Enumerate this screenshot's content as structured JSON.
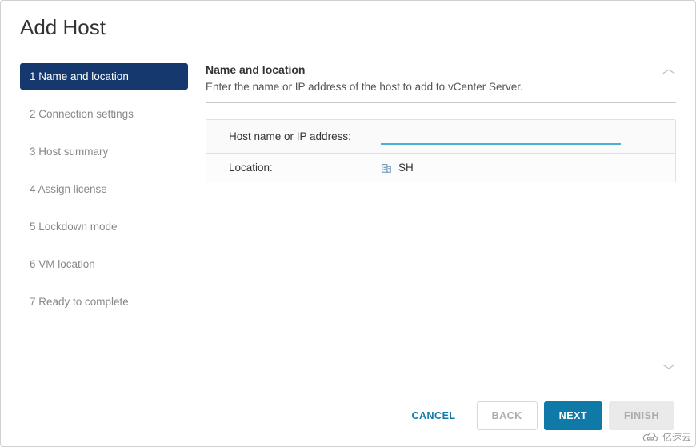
{
  "dialog": {
    "title": "Add Host"
  },
  "sidebar": {
    "steps": [
      {
        "label": "1 Name and location",
        "active": true
      },
      {
        "label": "2 Connection settings",
        "active": false
      },
      {
        "label": "3 Host summary",
        "active": false
      },
      {
        "label": "4 Assign license",
        "active": false
      },
      {
        "label": "5 Lockdown mode",
        "active": false
      },
      {
        "label": "6 VM location",
        "active": false
      },
      {
        "label": "7 Ready to complete",
        "active": false
      }
    ]
  },
  "content": {
    "heading": "Name and location",
    "description": "Enter the name or IP address of the host to add to vCenter Server.",
    "fields": {
      "hostname_label": "Host name or IP address:",
      "hostname_value": "",
      "location_label": "Location:",
      "location_value": "SH"
    }
  },
  "footer": {
    "cancel": "CANCEL",
    "back": "BACK",
    "next": "NEXT",
    "finish": "FINISH"
  },
  "watermark": {
    "text": "亿速云"
  }
}
